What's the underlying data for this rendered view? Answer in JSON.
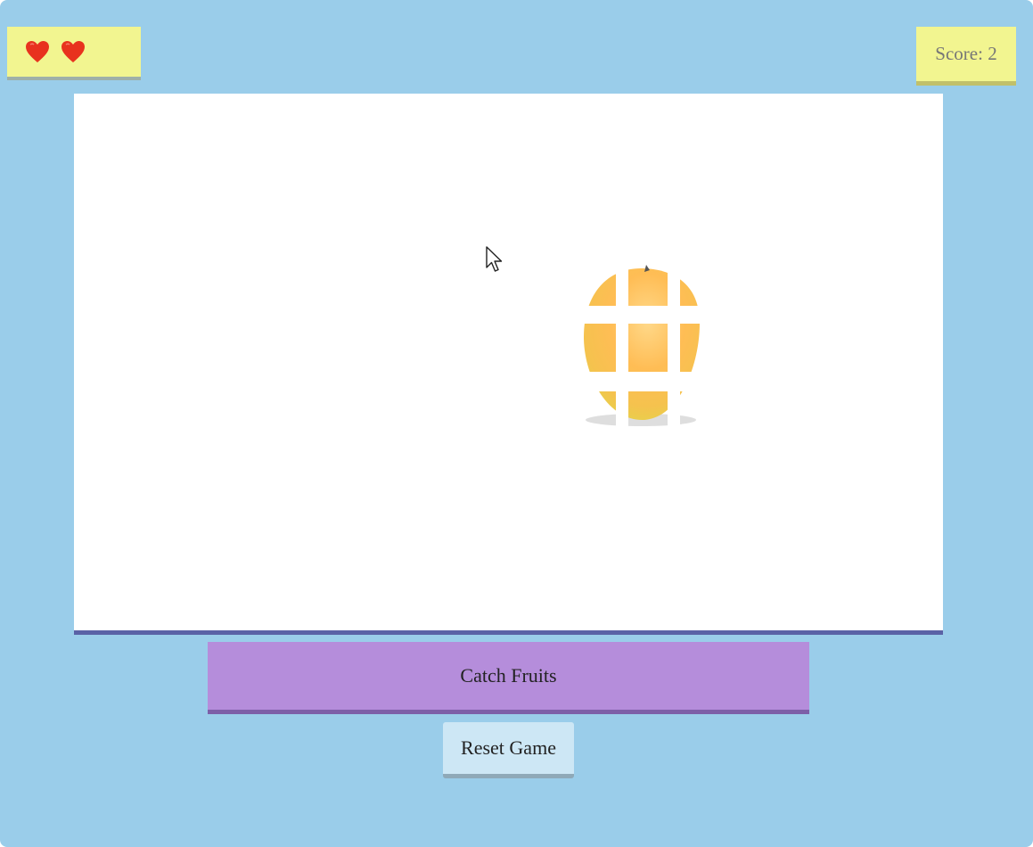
{
  "lives": {
    "count": 2,
    "icon": "heart-icon",
    "color": "#e8321e"
  },
  "score": {
    "label": "Score:",
    "value": "2"
  },
  "game": {
    "falling_fruit": "orange-fruit-icon",
    "fruit_color": "#ffb347"
  },
  "controls": {
    "catch_label": "Catch Fruits",
    "reset_label": "Reset Game"
  },
  "colors": {
    "background": "#9acdea",
    "lives_panel": "#f2f590",
    "score_panel": "#f2f590",
    "catch_bar": "#b58ddb",
    "reset_button": "#cde7f5"
  }
}
